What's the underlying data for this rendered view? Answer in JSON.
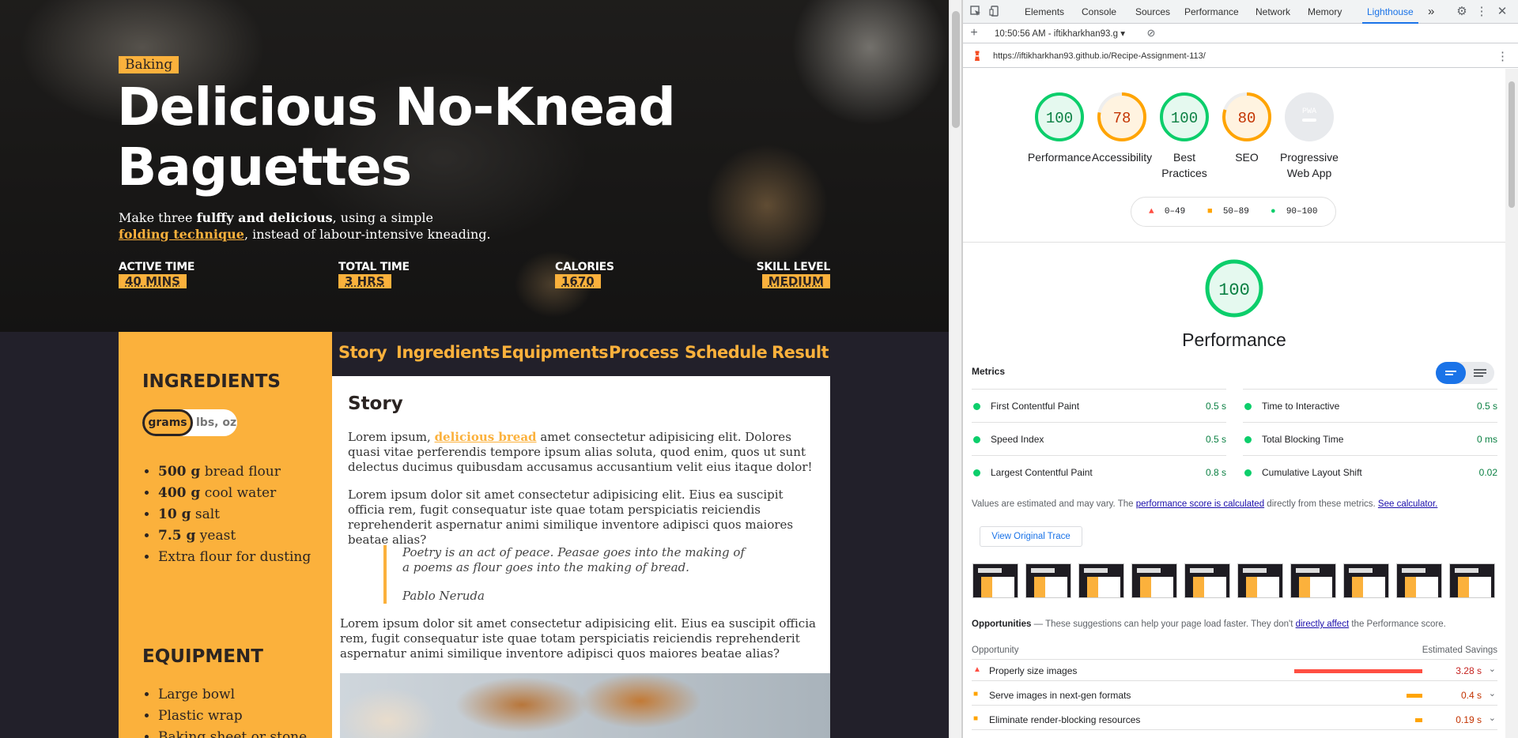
{
  "hero": {
    "tag": "Baking",
    "title": "Delicious No-Knead Baguettes",
    "subtitle_pre": "Make three ",
    "subtitle_bold": "fulffy and delicious",
    "subtitle_mid": ", using a simple",
    "subtitle_link": "folding technique",
    "subtitle_post": ", instead of labour-intensive kneading.",
    "stats": [
      {
        "label": "ACTIVE TIME",
        "value": "40 MINS"
      },
      {
        "label": "TOTAL TIME",
        "value": "3 HRS"
      },
      {
        "label": "CALORIES",
        "value": "1670"
      },
      {
        "label": "SKILL LEVEL",
        "value": "MEDIUM"
      }
    ]
  },
  "sidebar": {
    "ingredients_heading": "INGREDIENTS",
    "unit_grams": "grams",
    "unit_lbs": "lbs, oz",
    "ingredients": [
      {
        "amount": "500 g",
        "name": " bread flour"
      },
      {
        "amount": "400 g",
        "name": " cool water"
      },
      {
        "amount": "10 g",
        "name": " salt"
      },
      {
        "amount": "7.5 g",
        "name": " yeast"
      },
      {
        "amount": "",
        "name": "Extra flour for dusting"
      }
    ],
    "equipment_heading": "EQUIPMENT",
    "equipment": [
      "Large bowl",
      "Plastic wrap",
      "Baking sheet or stone"
    ]
  },
  "tabs": [
    "Story",
    "Ingredients",
    "Equipments",
    "Process",
    "Schedule",
    "Result"
  ],
  "story": {
    "heading": "Story",
    "p1_pre": "Lorem ipsum, ",
    "p1_link": "delicious bread",
    "p1_post": " amet consectetur adipisicing elit. Dolores quasi vitae perferendis tempore ipsum alias soluta, quod enim, quos ut sunt delectus ducimus quibusdam accusamus accusantium velit eius itaque dolor!",
    "p2": "Lorem ipsum dolor sit amet consectetur adipisicing elit. Eius ea suscipit officia rem, fugit consequatur iste quae totam perspiciatis reiciendis reprehenderit aspernatur animi similique inventore adipisci quos maiores beatae alias?",
    "quote": "Poetry is an act of peace. Peasae goes into the making of a poems as flour goes into the making of bread.",
    "quote_author": "Pablo Neruda",
    "p3": "Lorem ipsum dolor sit amet consectetur adipisicing elit. Eius ea suscipit officia rem, fugit consequatur iste quae totam perspiciatis reiciendis reprehenderit aspernatur animi similique inventore adipisci quos maiores beatae alias?"
  },
  "devtools": {
    "tabs": [
      "Elements",
      "Console",
      "Sources",
      "Performance",
      "Network",
      "Memory",
      "Lighthouse"
    ],
    "active_tab": "Lighthouse",
    "more": "»",
    "report_time": "10:50:56 AM - iftikharkhan93.g",
    "url": "https://iftikharkhan93.github.io/Recipe-Assignment-113/",
    "scores": [
      {
        "label": "Performance",
        "score": "100",
        "value": 100,
        "color": "#0cce6b"
      },
      {
        "label": "Accessibility",
        "score": "78",
        "value": 78,
        "color": "#ffa400"
      },
      {
        "label": "Best Practices",
        "score": "100",
        "value": 100,
        "color": "#0cce6b"
      },
      {
        "label": "SEO",
        "score": "80",
        "value": 80,
        "color": "#ffa400"
      },
      {
        "label": "Progressive Web App",
        "score": "PWA",
        "value": 0,
        "color": "#9aa0a6"
      }
    ],
    "legend": [
      {
        "range": "0–49",
        "color": "#ff4e42"
      },
      {
        "range": "50–89",
        "color": "#ffa400"
      },
      {
        "range": "90–100",
        "color": "#0cce6b"
      }
    ],
    "perf_score": "100",
    "perf_label": "Performance",
    "metrics_heading": "Metrics",
    "metrics": [
      {
        "name": "First Contentful Paint",
        "value": "0.5 s"
      },
      {
        "name": "Time to Interactive",
        "value": "0.5 s"
      },
      {
        "name": "Speed Index",
        "value": "0.5 s"
      },
      {
        "name": "Total Blocking Time",
        "value": "0 ms"
      },
      {
        "name": "Largest Contentful Paint",
        "value": "0.8 s"
      },
      {
        "name": "Cumulative Layout Shift",
        "value": "0.02"
      }
    ],
    "note_pre": "Values are estimated and may vary. The ",
    "note_link1": "performance score is calculated",
    "note_mid": " directly from these metrics. ",
    "note_link2": "See calculator.",
    "trace_button": "View Original Trace",
    "opp_heading": "Opportunities",
    "opp_desc_pre": " — These suggestions can help your page load faster. They don't ",
    "opp_desc_link": "directly affect",
    "opp_desc_post": " the Performance score.",
    "opp_col1": "Opportunity",
    "opp_col2": "Estimated Savings",
    "opportunities": [
      {
        "name": "Properly size images",
        "savings": "3.28 s",
        "severity": "fail",
        "fraction": 0.9
      },
      {
        "name": "Serve images in next-gen formats",
        "savings": "0.4 s",
        "severity": "average",
        "fraction": 0.11
      },
      {
        "name": "Eliminate render-blocking resources",
        "savings": "0.19 s",
        "severity": "average",
        "fraction": 0.05
      }
    ]
  }
}
